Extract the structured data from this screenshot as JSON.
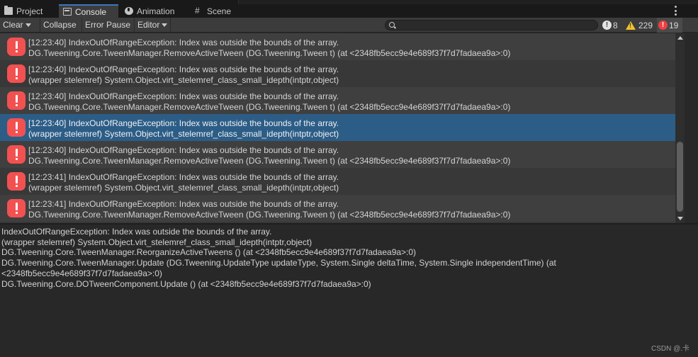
{
  "tabs": [
    {
      "label": "Project",
      "icon": "folder-icon"
    },
    {
      "label": "Console",
      "icon": "console-icon",
      "active": true
    },
    {
      "label": "Animation",
      "icon": "animation-icon"
    },
    {
      "label": "Scene",
      "icon": "scene-icon",
      "glyph": "#"
    }
  ],
  "toolbar": {
    "clear_label": "Clear",
    "collapse_label": "Collapse",
    "error_pause_label": "Error Pause",
    "editor_label": "Editor",
    "search_value": "",
    "search_placeholder": "",
    "info_count": "8",
    "warning_count": "229",
    "error_count": "19"
  },
  "log_entries": [
    {
      "line1": "[12:23:40] IndexOutOfRangeException: Index was outside the bounds of the array.",
      "line2": "DG.Tweening.Core.TweenManager.RemoveActiveTween (DG.Tweening.Tween t) (at <2348fb5ecc9e4e689f37f7d7fadaea9a>:0)"
    },
    {
      "line1": "[12:23:40] IndexOutOfRangeException: Index was outside the bounds of the array.",
      "line2": "(wrapper stelemref) System.Object.virt_stelemref_class_small_idepth(intptr,object)"
    },
    {
      "line1": "[12:23:40] IndexOutOfRangeException: Index was outside the bounds of the array.",
      "line2": "DG.Tweening.Core.TweenManager.RemoveActiveTween (DG.Tweening.Tween t) (at <2348fb5ecc9e4e689f37f7d7fadaea9a>:0)"
    },
    {
      "line1": "[12:23:40] IndexOutOfRangeException: Index was outside the bounds of the array.",
      "line2": "(wrapper stelemref) System.Object.virt_stelemref_class_small_idepth(intptr,object)",
      "selected": true
    },
    {
      "line1": "[12:23:40] IndexOutOfRangeException: Index was outside the bounds of the array.",
      "line2": "DG.Tweening.Core.TweenManager.RemoveActiveTween (DG.Tweening.Tween t) (at <2348fb5ecc9e4e689f37f7d7fadaea9a>:0)"
    },
    {
      "line1": "[12:23:41] IndexOutOfRangeException: Index was outside the bounds of the array.",
      "line2": "(wrapper stelemref) System.Object.virt_stelemref_class_small_idepth(intptr,object)"
    },
    {
      "line1": "[12:23:41] IndexOutOfRangeException: Index was outside the bounds of the array.",
      "line2": "DG.Tweening.Core.TweenManager.RemoveActiveTween (DG.Tweening.Tween t) (at <2348fb5ecc9e4e689f37f7d7fadaea9a>:0)"
    }
  ],
  "detail_lines": [
    "IndexOutOfRangeException: Index was outside the bounds of the array.",
    "(wrapper stelemref) System.Object.virt_stelemref_class_small_idepth(intptr,object)",
    "DG.Tweening.Core.TweenManager.ReorganizeActiveTweens () (at <2348fb5ecc9e4e689f37f7d7fadaea9a>:0)",
    "DG.Tweening.Core.TweenManager.Update (DG.Tweening.UpdateType updateType, System.Single deltaTime, System.Single independentTime) (at",
    "<2348fb5ecc9e4e689f37f7d7fadaea9a>:0)",
    "DG.Tweening.Core.DOTweenComponent.Update () (at <2348fb5ecc9e4e689f37f7d7fadaea9a>:0)"
  ],
  "watermark": "CSDN @.卡",
  "colors": {
    "accent": "#3a79bb",
    "selected_row": "#2c5d87",
    "error": "#f25151",
    "warning": "#f2c02a"
  }
}
